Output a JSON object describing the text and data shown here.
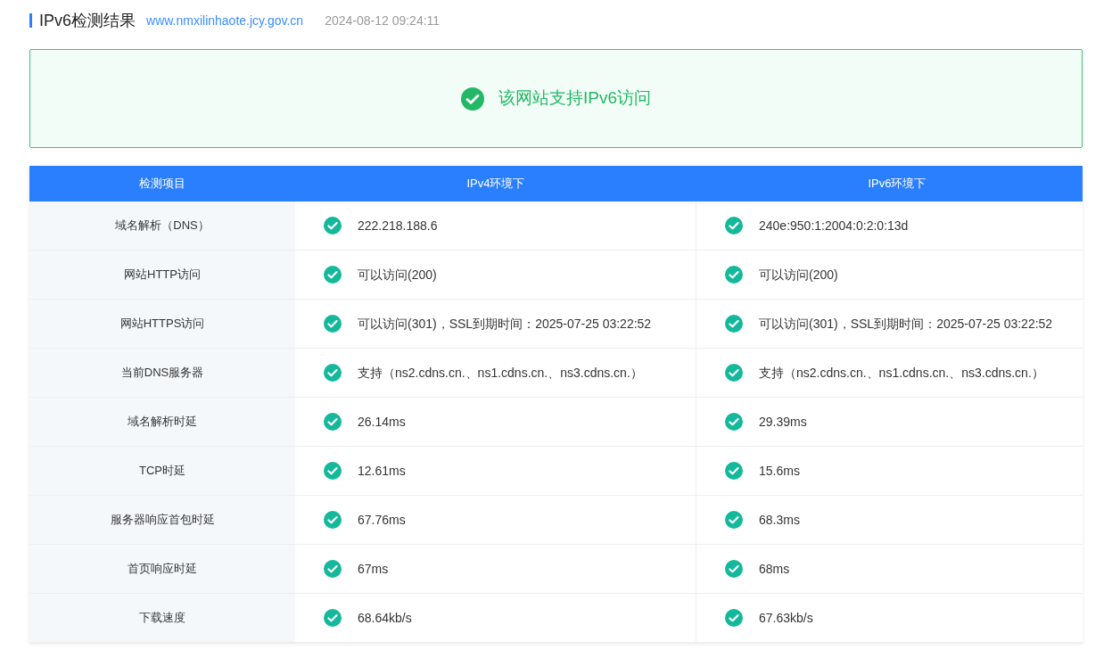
{
  "header": {
    "title": "IPv6检测结果",
    "domain": "www.nmxilinhaote.jcy.gov.cn",
    "time": "2024-08-12 09:24:11"
  },
  "banner": {
    "passed": true,
    "message": "该网站支持IPv6访问"
  },
  "table": {
    "columns": [
      "检测项目",
      "IPv4环境下",
      "IPv6环境下"
    ],
    "rows": [
      {
        "item": "域名解析（DNS）",
        "ipv4": {
          "passed": true,
          "text": "222.218.188.6"
        },
        "ipv6": {
          "passed": true,
          "text": "240e:950:1:2004:0:2:0:13d"
        }
      },
      {
        "item": "网站HTTP访问",
        "ipv4": {
          "passed": true,
          "text": "可以访问(200)"
        },
        "ipv6": {
          "passed": true,
          "text": "可以访问(200)"
        }
      },
      {
        "item": "网站HTTPS访问",
        "ipv4": {
          "passed": true,
          "text": "可以访问(301)，SSL到期时间：2025-07-25 03:22:52"
        },
        "ipv6": {
          "passed": true,
          "text": "可以访问(301)，SSL到期时间：2025-07-25 03:22:52"
        }
      },
      {
        "item": "当前DNS服务器",
        "ipv4": {
          "passed": true,
          "text": "支持（ns2.cdns.cn.、ns1.cdns.cn.、ns3.cdns.cn.）"
        },
        "ipv6": {
          "passed": true,
          "text": "支持（ns2.cdns.cn.、ns1.cdns.cn.、ns3.cdns.cn.）"
        }
      },
      {
        "item": "域名解析时延",
        "ipv4": {
          "passed": true,
          "text": "26.14ms"
        },
        "ipv6": {
          "passed": true,
          "text": "29.39ms"
        }
      },
      {
        "item": "TCP时延",
        "ipv4": {
          "passed": true,
          "text": "12.61ms"
        },
        "ipv6": {
          "passed": true,
          "text": "15.6ms"
        }
      },
      {
        "item": "服务器响应首包时延",
        "ipv4": {
          "passed": true,
          "text": "67.76ms"
        },
        "ipv6": {
          "passed": true,
          "text": "68.3ms"
        }
      },
      {
        "item": "首页响应时延",
        "ipv4": {
          "passed": true,
          "text": "67ms"
        },
        "ipv6": {
          "passed": true,
          "text": "68ms"
        }
      },
      {
        "item": "下载速度",
        "ipv4": {
          "passed": true,
          "text": "68.64kb/s"
        },
        "ipv6": {
          "passed": true,
          "text": "67.63kb/s"
        }
      }
    ]
  }
}
